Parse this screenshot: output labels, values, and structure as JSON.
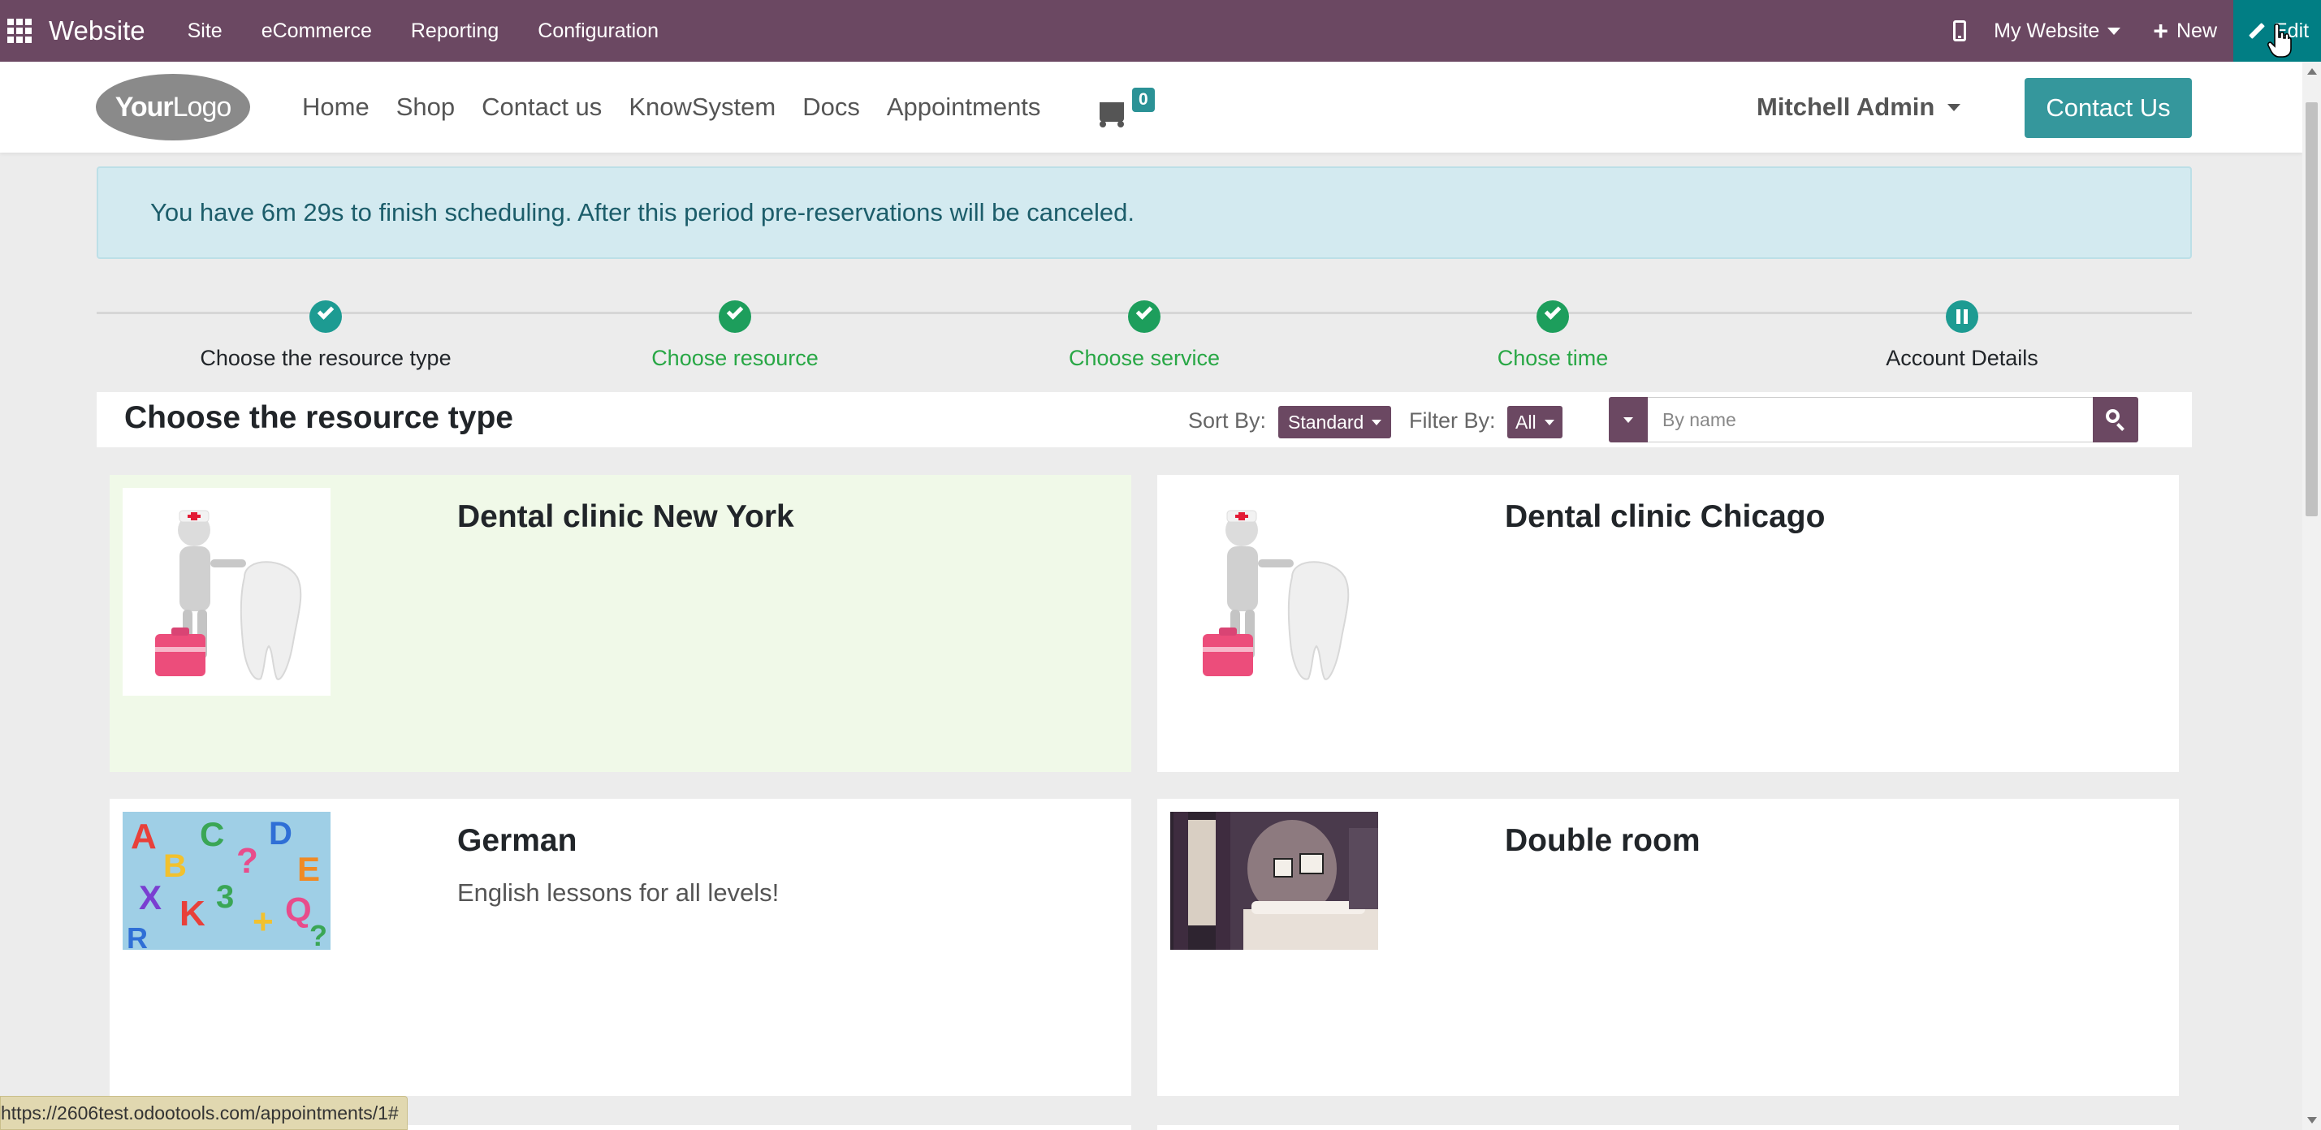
{
  "admin_bar": {
    "brand": "Website",
    "menu": [
      "Site",
      "eCommerce",
      "Reporting",
      "Configuration"
    ],
    "website_selector": "My Website",
    "new_label": "New",
    "edit_label": "Edit"
  },
  "header": {
    "logo_text_bold": "Your",
    "logo_text": "Logo",
    "nav": [
      "Home",
      "Shop",
      "Contact us",
      "KnowSystem",
      "Docs",
      "Appointments"
    ],
    "cart_count": "0",
    "user_name": "Mitchell Admin",
    "contact_button": "Contact Us"
  },
  "alert": {
    "message": "You have 6m 29s to finish scheduling. After this period pre-reservations will be canceled."
  },
  "steps": [
    {
      "label": "Choose the resource type",
      "state": "current"
    },
    {
      "label": "Choose resource",
      "state": "done"
    },
    {
      "label": "Choose service",
      "state": "done"
    },
    {
      "label": "Chose time",
      "state": "done"
    },
    {
      "label": "Account Details",
      "state": "pending"
    }
  ],
  "section": {
    "title": "Choose the resource type",
    "sort_label": "Sort By:",
    "sort_value": "Standard",
    "filter_label": "Filter By:",
    "filter_value": "All",
    "search_placeholder": "By name"
  },
  "cards": [
    {
      "title": "Dental clinic New York",
      "description": "",
      "image": "dentist-tooth-figure-icon",
      "highlighted": true
    },
    {
      "title": "Dental clinic Chicago",
      "description": "",
      "image": "dentist-tooth-figure-icon",
      "highlighted": false
    },
    {
      "title": "German",
      "description": "English lessons for all levels!",
      "image": "colorful-letters-icon",
      "highlighted": false
    },
    {
      "title": "Double room",
      "description": "",
      "image": "hotel-room-icon",
      "highlighted": false
    }
  ],
  "status_bar": {
    "url": "https://2606test.odootools.com/appointments/1#"
  },
  "colors": {
    "admin_bar": "#6b4862",
    "edit_button": "#017e84",
    "accent_teal": "#35979c",
    "step_done": "#1d9e5c",
    "alert_bg": "#d3eaf0",
    "card_highlight": "#f0f9e8"
  }
}
